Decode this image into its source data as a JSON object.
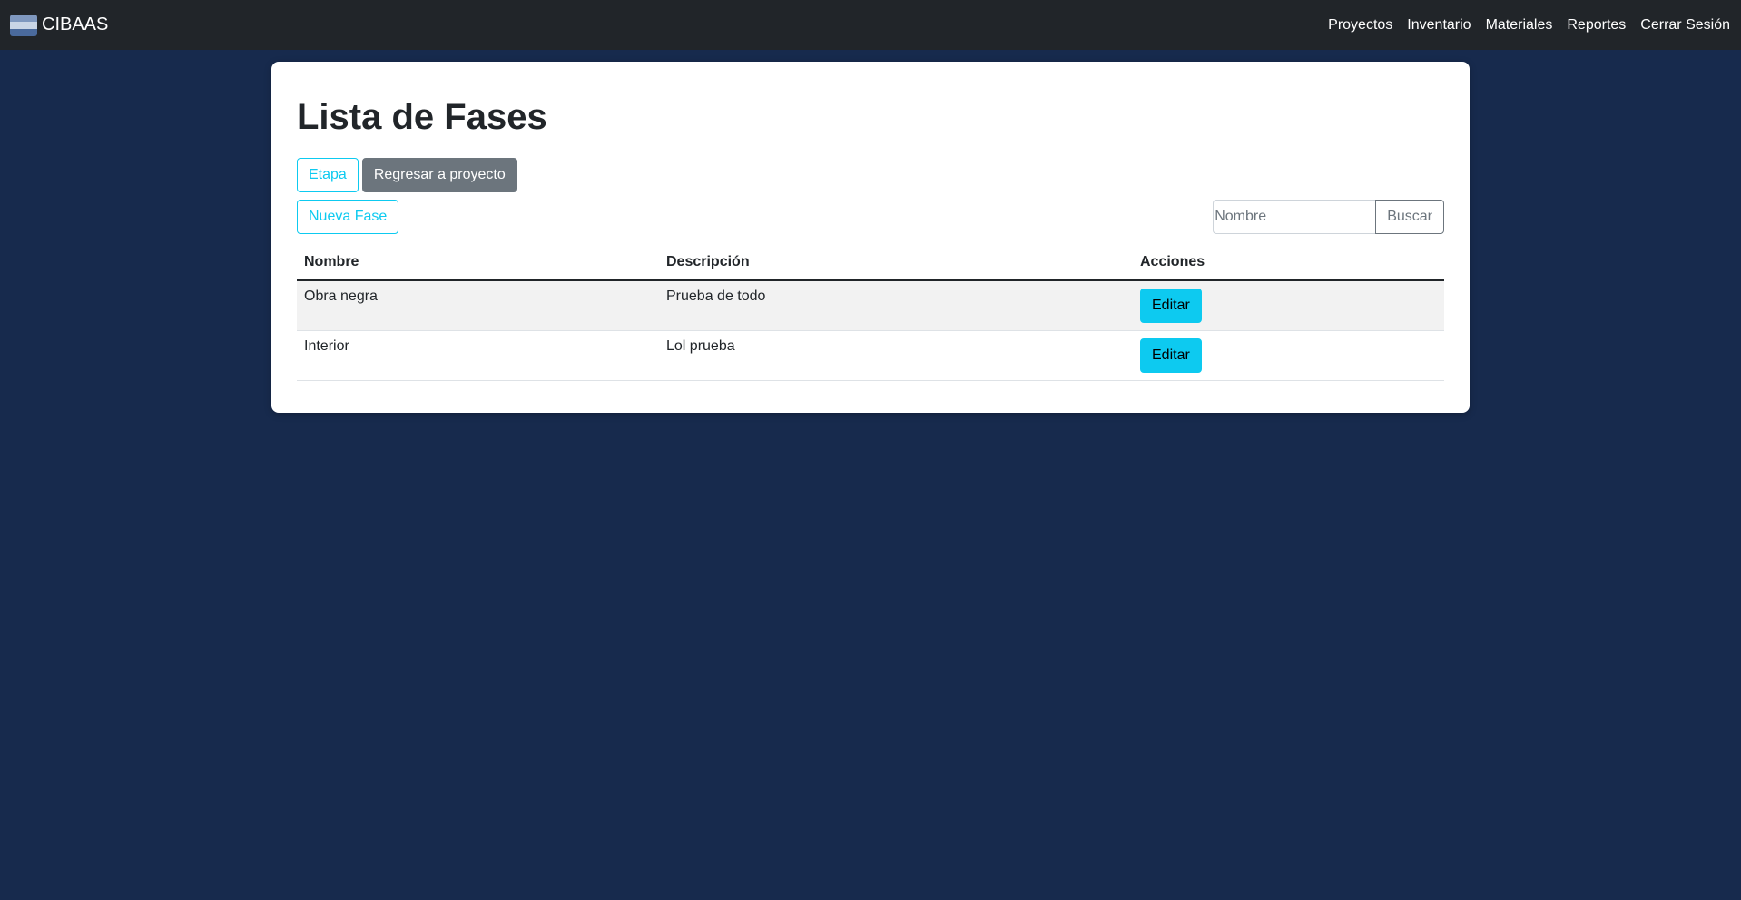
{
  "navbar": {
    "brand": "CIBAAS",
    "links": [
      "Proyectos",
      "Inventario",
      "Materiales",
      "Reportes",
      "Cerrar Sesión"
    ]
  },
  "page": {
    "title": "Lista de Fases",
    "etapa_button": "Etapa",
    "back_button": "Regresar a proyecto",
    "new_button": "Nueva Fase",
    "search": {
      "placeholder": "Nombre",
      "value": "",
      "button": "Buscar"
    }
  },
  "table": {
    "headers": [
      "Nombre",
      "Descripción",
      "Acciones"
    ],
    "rows": [
      {
        "nombre": "Obra negra",
        "descripcion": "Prueba de todo",
        "action": "Editar"
      },
      {
        "nombre": "Interior",
        "descripcion": "Lol prueba",
        "action": "Editar"
      }
    ]
  },
  "colors": {
    "background": "#172a4d",
    "navbar": "#212529",
    "info": "#0dcaf0",
    "secondary": "#6c757d"
  }
}
